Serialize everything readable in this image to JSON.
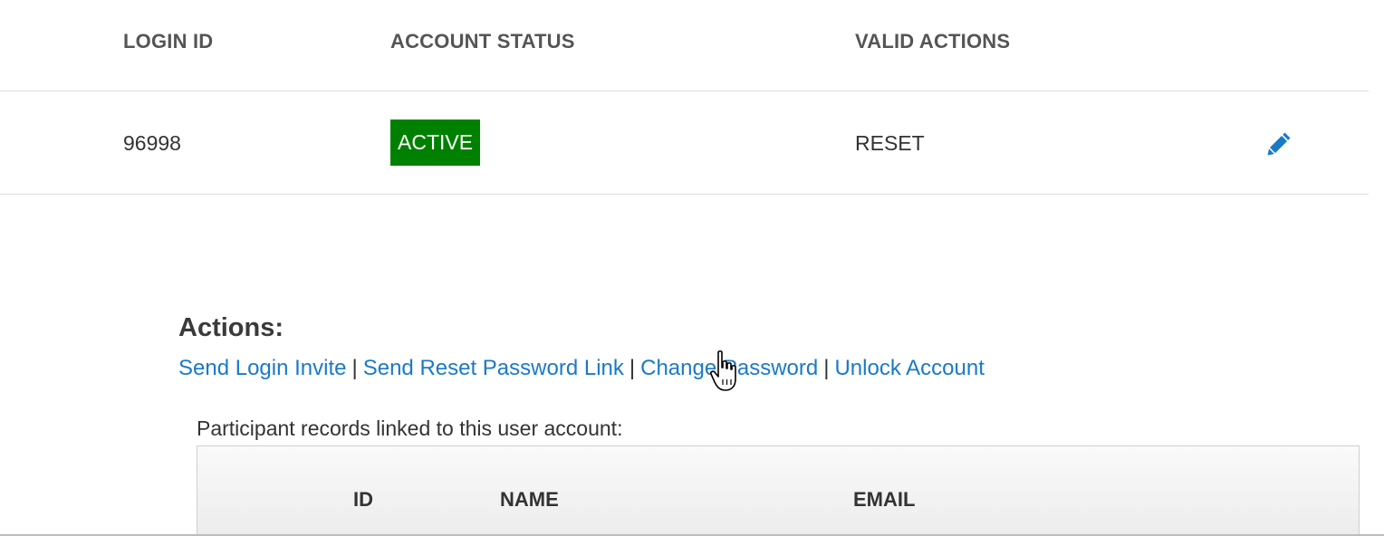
{
  "accounts_table": {
    "headers": {
      "login_id": "LOGIN ID",
      "account_status": "ACCOUNT STATUS",
      "valid_actions": "VALID ACTIONS"
    },
    "rows": [
      {
        "login_id": "96998",
        "account_status": "ACTIVE",
        "valid_actions": "RESET",
        "edit_icon": "pencil-icon"
      }
    ]
  },
  "actions": {
    "title": "Actions:",
    "links": [
      "Send Login Invite",
      "Send Reset Password Link",
      "Change Password",
      "Unlock Account"
    ],
    "separator": "|"
  },
  "linked_records": {
    "caption": "Participant records linked to this user account:",
    "headers": {
      "id": "ID",
      "name": "NAME",
      "email": "EMAIL"
    }
  },
  "colors": {
    "active_badge": "#008000",
    "link": "#1a7ac8",
    "edit_icon": "#1a7ac8"
  }
}
